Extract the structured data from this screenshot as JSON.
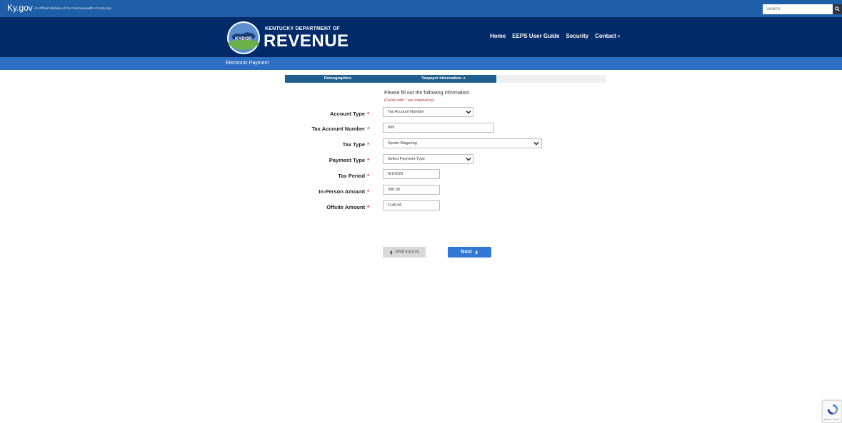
{
  "topbar": {
    "brand": "Ky.gov",
    "subtitle": "An Official Website of the Commonwealth of Kentucky",
    "search_placeholder": "Search"
  },
  "header": {
    "logo_text": "KYDOR",
    "dept_line": "KENTUCKY DEPARTMENT OF",
    "title": "REVENUE",
    "nav": {
      "home": "Home",
      "guide": "EEPS User Guide",
      "security": "Security",
      "contact": "Contact"
    }
  },
  "subbar": {
    "label": "Electronic Payment"
  },
  "steps": {
    "step1": "Demographics",
    "step2": "Taxpayer Information ➔"
  },
  "form": {
    "intro": "Please fill out the following information.",
    "mandatory": "(Fields with * are mandatory)",
    "required_mark": "*",
    "account_type": {
      "label": "Account Type",
      "value": "Tax Account Number"
    },
    "tax_account_number": {
      "label": "Tax Account Number",
      "value": "999"
    },
    "tax_type": {
      "label": "Tax Type",
      "value": "Sports Wagering"
    },
    "payment_type": {
      "label": "Payment Type",
      "value": "Select Payment Type"
    },
    "tax_period": {
      "label": "Tax Period",
      "value": "9/1/2023"
    },
    "in_person_amount": {
      "label": "In-Person Amount",
      "value": "390.00"
    },
    "offsite_amount": {
      "label": "Offsite Amount",
      "value": "1140.00"
    }
  },
  "buttons": {
    "previous": "PREVIOUS",
    "next": "Next"
  },
  "captcha": {
    "text": "Privacy - Terms"
  },
  "colors": {
    "topbar": "#1f5fa8",
    "header": "#002a68",
    "subbar": "#2e6ec2",
    "step": "#1f5f8f",
    "next_button": "#2f78d4",
    "required": "#c62828"
  }
}
